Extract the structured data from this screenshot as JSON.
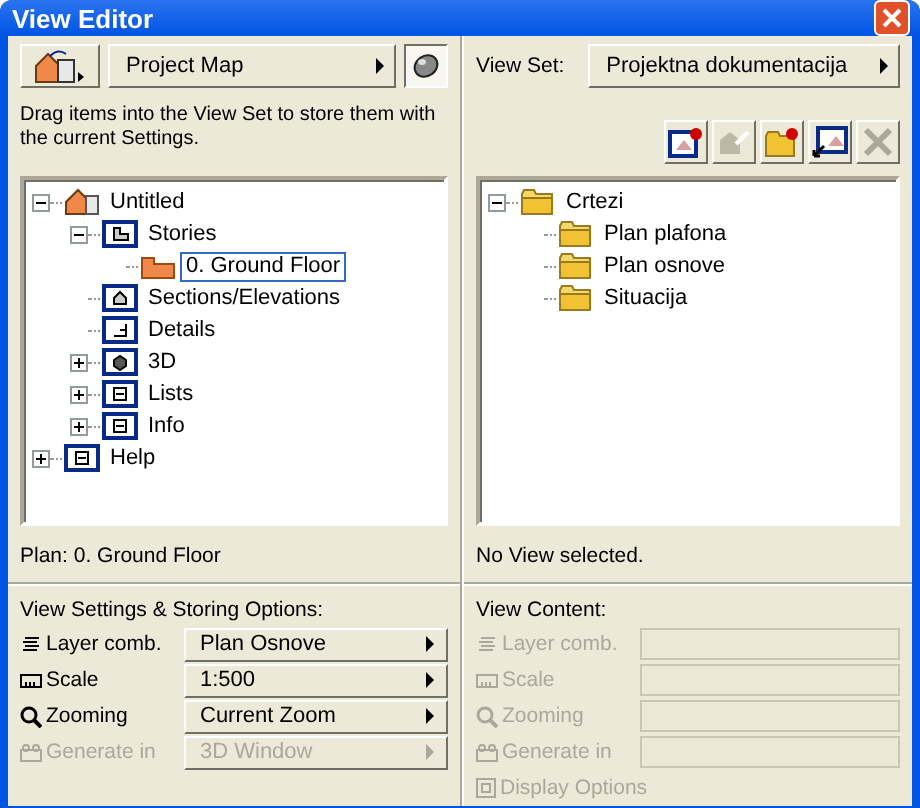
{
  "window": {
    "title": "View Editor"
  },
  "left": {
    "source_menu": {
      "value": "Project Map"
    },
    "navigator_toggle": {
      "selected": true
    },
    "hint": "Drag items into the View Set to store them with the current Settings.",
    "tree": [
      {
        "label": "Untitled",
        "kind": "project",
        "expanded": true,
        "selected": false,
        "children": [
          {
            "label": "Stories",
            "kind": "stories",
            "expanded": true,
            "selected": false,
            "children": [
              {
                "label": "0. Ground Floor",
                "kind": "floor",
                "selected": true
              }
            ]
          },
          {
            "label": "Sections/Elevations",
            "kind": "section",
            "selected": false
          },
          {
            "label": "Details",
            "kind": "detail",
            "selected": false
          },
          {
            "label": "3D",
            "kind": "model",
            "expanded": false,
            "selected": false
          },
          {
            "label": "Lists",
            "kind": "list",
            "expanded": false,
            "selected": false
          },
          {
            "label": "Info",
            "kind": "list",
            "expanded": false,
            "selected": false
          }
        ]
      },
      {
        "label": "Help",
        "kind": "list",
        "expanded": false,
        "selected": false
      }
    ],
    "status": "Plan: 0. Ground Floor",
    "settings": {
      "title": "View Settings & Storing Options:",
      "rows": [
        {
          "kind": "layers",
          "label": "Layer comb.",
          "value": "Plan Osnove",
          "disabled": false
        },
        {
          "kind": "scale",
          "label": "Scale",
          "value": "1:500",
          "disabled": false
        },
        {
          "kind": "zoom",
          "label": "Zooming",
          "value": "Current Zoom",
          "disabled": false
        },
        {
          "kind": "generate",
          "label": "Generate in",
          "value": "3D Window",
          "disabled": true
        }
      ]
    }
  },
  "right": {
    "view_set": {
      "label": "View Set:",
      "value": "Projektna dokumentacija"
    },
    "toolbar": [
      {
        "kind": "new-view",
        "disabled": false
      },
      {
        "kind": "redefine",
        "disabled": true
      },
      {
        "kind": "new-folder",
        "disabled": false
      },
      {
        "kind": "clone",
        "disabled": false
      },
      {
        "kind": "delete",
        "disabled": true
      }
    ],
    "tree": [
      {
        "label": "Crtezi",
        "kind": "folder",
        "expanded": true,
        "selected": false,
        "children": [
          {
            "label": "Plan plafona",
            "kind": "folder",
            "selected": false
          },
          {
            "label": "Plan osnove",
            "kind": "folder",
            "selected": false
          },
          {
            "label": "Situacija",
            "kind": "folder",
            "selected": false
          }
        ]
      }
    ],
    "status": "No View selected.",
    "content": {
      "title": "View Content:",
      "rows": [
        {
          "kind": "layers",
          "label": "Layer comb.",
          "disabled": true
        },
        {
          "kind": "scale",
          "label": "Scale",
          "disabled": true
        },
        {
          "kind": "zoom",
          "label": "Zooming",
          "disabled": true
        },
        {
          "kind": "generate",
          "label": "Generate in",
          "disabled": true
        }
      ],
      "display_options": {
        "label": "Display Options",
        "disabled": true
      }
    }
  }
}
